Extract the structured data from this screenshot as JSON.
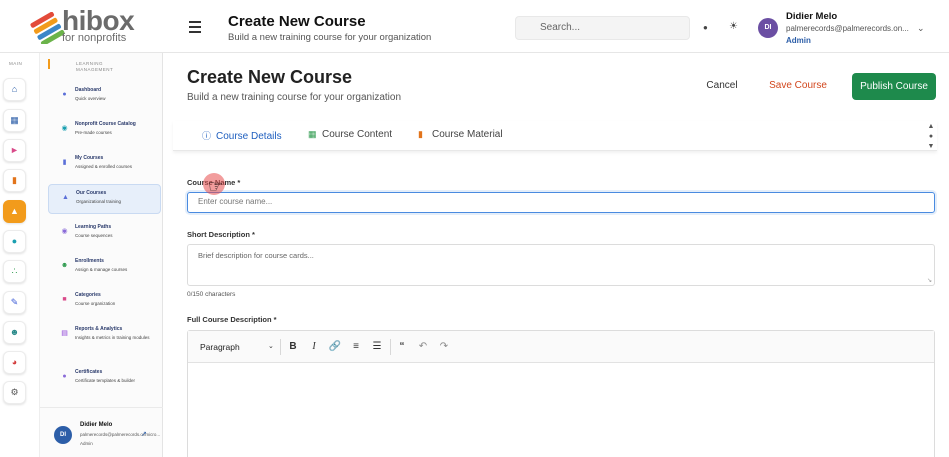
{
  "brand": {
    "name": "hibox",
    "tagline": "for nonprofits"
  },
  "header": {
    "title": "Create New Course",
    "subtitle": "Build a new training course for your organization",
    "search_placeholder": "Search...",
    "user": {
      "initials": "DI",
      "name": "Didier Melo",
      "email": "palmerecords@palmerecords.on...",
      "role": "Admin"
    }
  },
  "rail": {
    "section_label": "MAIN"
  },
  "sidebar": {
    "section_label": "LEARNING MANAGEMENT",
    "items": [
      {
        "title": "Dashboard",
        "desc": "Quick overview",
        "icon": "dashboard-icon"
      },
      {
        "title": "Nonprofit Course Catalog",
        "desc": "Pre-made courses",
        "icon": "catalog-icon"
      },
      {
        "title": "My Courses",
        "desc": "Assigned & enrolled courses",
        "icon": "book-icon"
      },
      {
        "title": "Our Courses",
        "desc": "Organizational training",
        "icon": "graduation-cap-icon"
      },
      {
        "title": "Learning Paths",
        "desc": "Course sequences",
        "icon": "path-icon"
      },
      {
        "title": "Enrollments",
        "desc": "Assign & manage courses",
        "icon": "users-icon"
      },
      {
        "title": "Categories",
        "desc": "Course organization",
        "icon": "folder-icon"
      },
      {
        "title": "Reports & Analytics",
        "desc": "Insights & metrics in training modules",
        "icon": "chart-icon"
      },
      {
        "title": "Certificates",
        "desc": "Certificate templates & builder",
        "icon": "certificate-icon"
      }
    ],
    "footer_user": {
      "initials": "DI",
      "name": "Didier Melo",
      "email": "palmerecords@palmerecords.onmicro...",
      "role": "Admin"
    }
  },
  "main": {
    "title": "Create New Course",
    "subtitle": "Build a new training course for your organization",
    "actions": {
      "cancel": "Cancel",
      "save": "Save Course",
      "publish": "Publish Course"
    },
    "tabs": [
      {
        "label": "Course Details",
        "icon": "info-icon"
      },
      {
        "label": "Course Content",
        "icon": "book-open-icon"
      },
      {
        "label": "Course Material",
        "icon": "document-icon"
      }
    ],
    "form": {
      "course_name_label": "Course Name *",
      "course_name_placeholder": "Enter course name...",
      "short_desc_label": "Short Description *",
      "short_desc_placeholder": "Brief description for course cards...",
      "char_count": "0/150 characters",
      "full_desc_label": "Full Course Description *",
      "editor_format": "Paragraph"
    }
  },
  "colors": {
    "accent": "#f29b1b",
    "primary_blue": "#1f5fbf",
    "publish_green": "#1e8a4c",
    "save_orange": "#d2461c"
  }
}
